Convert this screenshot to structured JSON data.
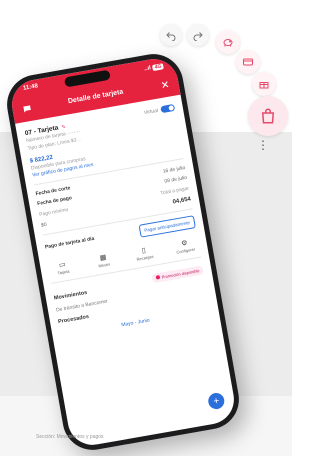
{
  "toolbar": {
    "undo_icon": "undo-icon",
    "redo_icon": "redo-icon",
    "tools": [
      "pig-icon",
      "card-icon",
      "gift-icon",
      "shopping-bag-icon"
    ],
    "more_icon": "more-vertical-icon"
  },
  "status_bar": {
    "time": "11:48",
    "signal": "..ıl",
    "battery": "4G"
  },
  "header": {
    "title": "Detalle de tarjeta",
    "chat_icon": "chat-icon",
    "close_icon": "close-icon"
  },
  "card": {
    "name": "07 - Tarjeta",
    "toggle_label": "Virtual",
    "number_line": "Número de tarjeta ········",
    "type_line": "Tipo de plan: Línea $3 ..",
    "amount": "$ 822,22",
    "available_label": "Disponible para compras",
    "link_text": "Ver gráfico de pagos al mes"
  },
  "dates": {
    "cut_label": "Fecha de corte",
    "cut_value": "16 de julio",
    "pay_label": "Fecha de pago",
    "pay_value": "08 de julio",
    "min_label": "Pago mínimo",
    "min_value": "$0",
    "total_label": "Total a pagar",
    "total_value": "04,654"
  },
  "payment": {
    "label": "Pago de tarjeta al día",
    "button": "Pagar anticipadamente"
  },
  "quick_actions": [
    {
      "icon": "card-icon",
      "label": "Tarjeta"
    },
    {
      "icon": "calendar-icon",
      "label": "Meses"
    },
    {
      "icon": "phone-icon",
      "label": "Recargas"
    },
    {
      "icon": "settings-icon",
      "label": "Configurar"
    }
  ],
  "movements": {
    "title": "Movimientos",
    "chip": "Promoción disponible",
    "row": "De tránsito a Bancomer",
    "processed_title": "Procesados",
    "filter": "Mayo - Junio"
  },
  "fab_label": "+",
  "footer_note": "Sección: Movimientos y pagos"
}
